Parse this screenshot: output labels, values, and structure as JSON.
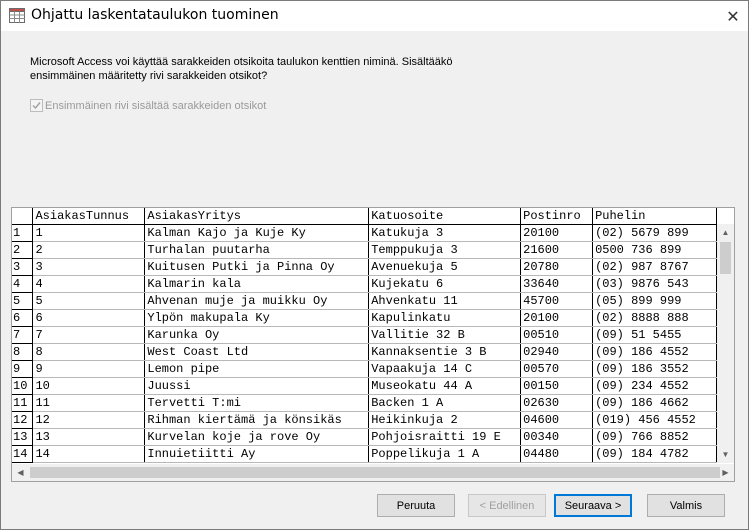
{
  "window": {
    "title": "Ohjattu laskentataulukon tuominen",
    "close_glyph": "✕"
  },
  "description": "Microsoft Access voi käyttää sarakkeiden otsikoita taulukon kenttien niminä. Sisältääkö ensimmäinen määritetty rivi sarakkeiden otsikot?",
  "checkbox": {
    "label": "Ensimmäinen rivi sisältää sarakkeiden otsikot",
    "checked": true,
    "enabled": false
  },
  "grid": {
    "columns": [
      "AsiakasTunnus",
      "AsiakasYritys",
      "Katuosoite",
      "Postinro",
      "Puhelin"
    ],
    "rows": [
      {
        "n": "1",
        "cells": [
          "1",
          "Kalman Kajo ja Kuje Ky",
          "Katukuja 3",
          "20100",
          "(02) 5679 899"
        ]
      },
      {
        "n": "2",
        "cells": [
          "2",
          "Turhalan puutarha",
          "Temppukuja 3",
          "21600",
          "0500 736 899"
        ]
      },
      {
        "n": "3",
        "cells": [
          "3",
          "Kuitusen Putki ja Pinna Oy",
          "Avenuekuja 5",
          "20780",
          "(02) 987 8767"
        ]
      },
      {
        "n": "4",
        "cells": [
          "4",
          "Kalmarin kala",
          "Kujekatu 6",
          "33640",
          "(03) 9876 543"
        ]
      },
      {
        "n": "5",
        "cells": [
          "5",
          "Ahvenan muje ja muikku Oy",
          "Ahvenkatu 11",
          "45700",
          "(05) 899 999"
        ]
      },
      {
        "n": "6",
        "cells": [
          "6",
          "Ylpön makupala Ky",
          "Kapulinkatu",
          "20100",
          "(02) 8888 888"
        ]
      },
      {
        "n": "7",
        "cells": [
          "7",
          "Karunka Oy",
          "Vallitie 32 B",
          "00510",
          "(09) 51 5455"
        ]
      },
      {
        "n": "8",
        "cells": [
          "8",
          "West Coast Ltd",
          "Kannaksentie 3 B",
          "02940",
          "(09) 186 4552"
        ]
      },
      {
        "n": "9",
        "cells": [
          "9",
          "Lemon pipe",
          "Vapaakuja 14 C",
          "00570",
          "(09) 186 3552"
        ]
      },
      {
        "n": "10",
        "cells": [
          "10",
          "Juussi",
          "Museokatu 44 A",
          "00150",
          "(09) 234 4552"
        ]
      },
      {
        "n": "11",
        "cells": [
          "11",
          "Tervetti T:mi",
          "Backen 1 A",
          "02630",
          "(09) 186 4662"
        ]
      },
      {
        "n": "12",
        "cells": [
          "12",
          "Rihman kiertämä ja könsikäs",
          "Heikinkuja 2",
          "04600",
          "(019) 456 4552"
        ]
      },
      {
        "n": "13",
        "cells": [
          "13",
          "Kurvelan koje ja rove Oy",
          "Pohjoisraitti 19 E",
          "00340",
          "(09) 766 8852"
        ]
      },
      {
        "n": "14",
        "cells": [
          "14",
          "Innuietiitti Ay",
          "Poppelikuja 1 A",
          "04480",
          "(09) 184 4782"
        ]
      }
    ]
  },
  "buttons": {
    "cancel": "Peruuta",
    "back": "< Edellinen",
    "next": "Seuraava >",
    "finish": "Valmis"
  },
  "icons": {
    "app": "spreadsheet-icon",
    "checkmark": "checkmark-icon",
    "scroll_up": "▲",
    "scroll_down": "▼",
    "scroll_left": "◀",
    "scroll_right": "▶"
  }
}
